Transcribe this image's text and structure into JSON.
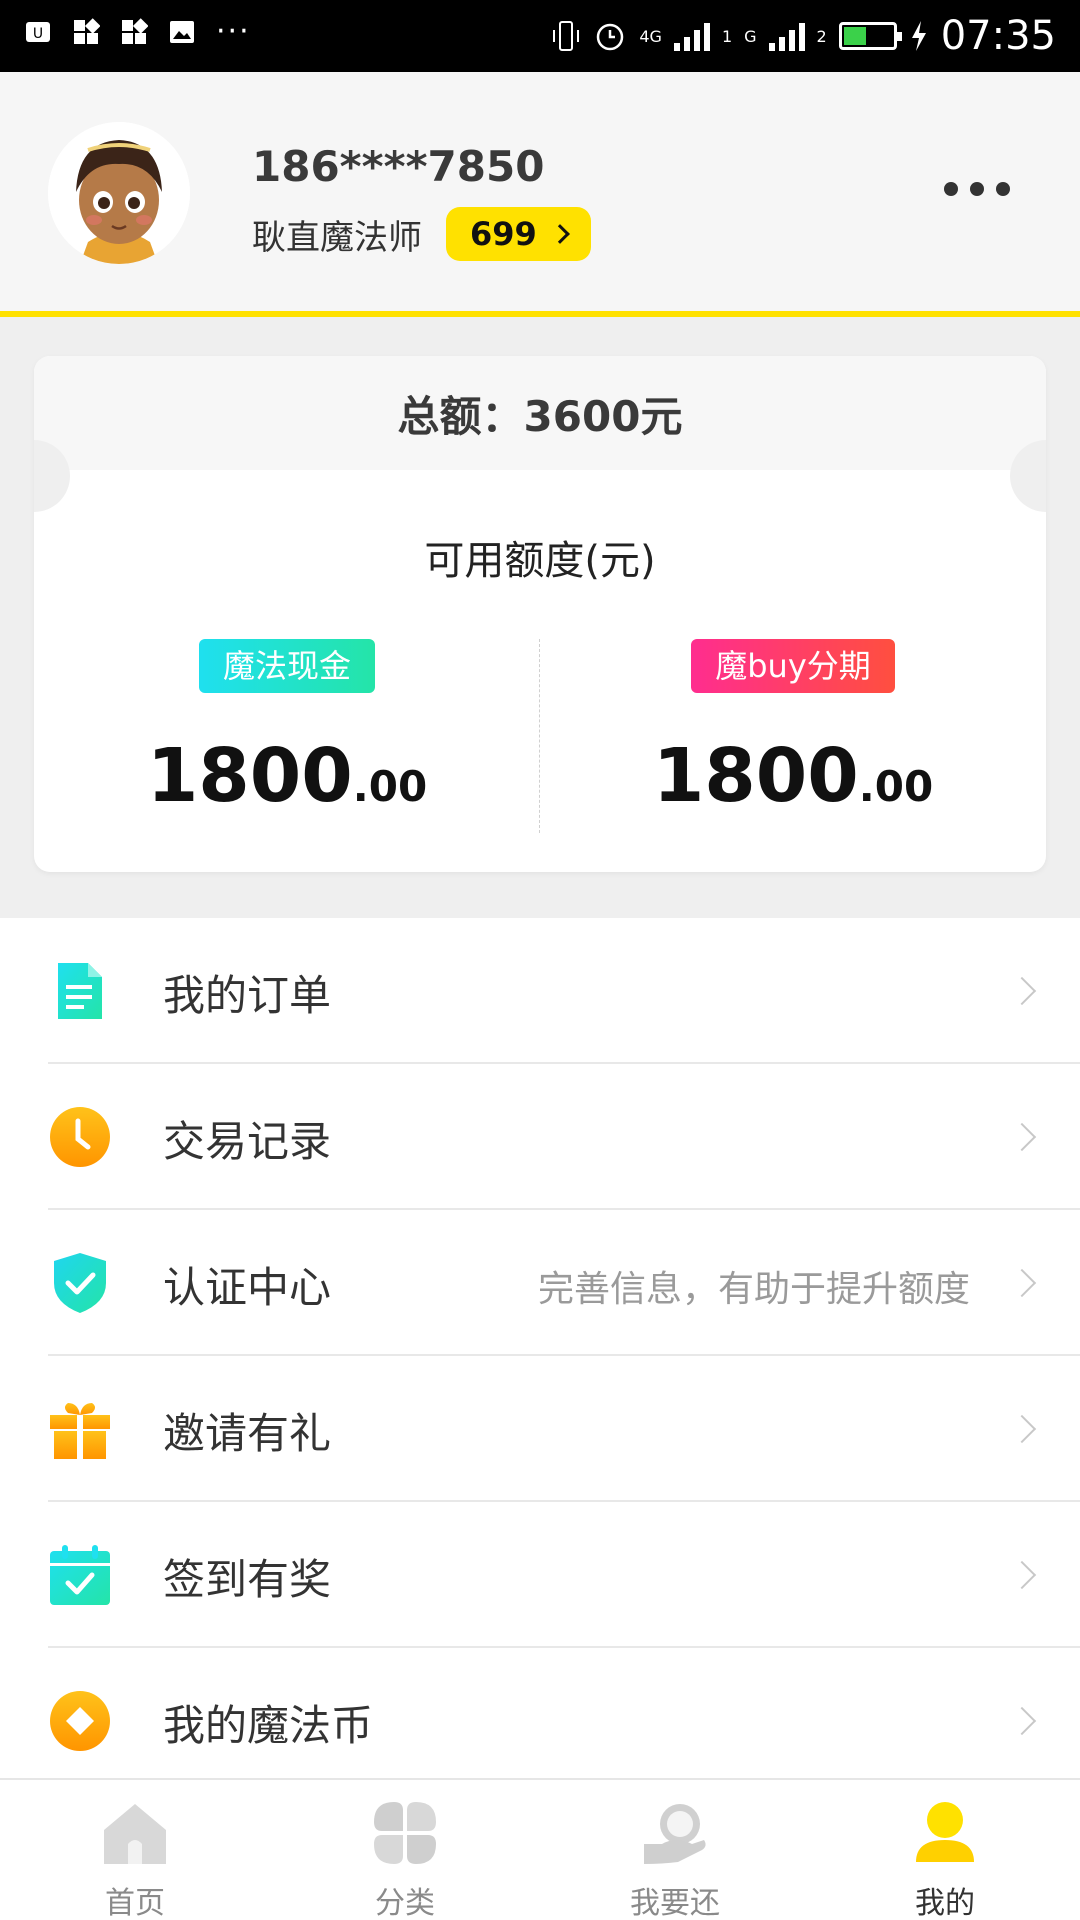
{
  "status_bar": {
    "network_1": "4G",
    "network_2": "G",
    "sim_1": "1",
    "sim_2": "2",
    "time": "07:35",
    "overflow": "···"
  },
  "profile": {
    "phone": "186****7850",
    "rank": "耿直魔法师",
    "score": "699"
  },
  "credit": {
    "total_label": "总额：3600元",
    "available_title": "可用额度(元)",
    "cash": {
      "tag": "魔法现金",
      "int": "1800",
      "dec": ".00"
    },
    "installment": {
      "tag": "魔buy分期",
      "int": "1800",
      "dec": ".00"
    }
  },
  "menu": [
    {
      "label": "我的订单",
      "hint": ""
    },
    {
      "label": "交易记录",
      "hint": ""
    },
    {
      "label": "认证中心",
      "hint": "完善信息，有助于提升额度"
    },
    {
      "label": "邀请有礼",
      "hint": ""
    },
    {
      "label": "签到有奖",
      "hint": ""
    },
    {
      "label": "我的魔法币",
      "hint": ""
    }
  ],
  "tabs": [
    {
      "label": "首页",
      "icon": "home-icon"
    },
    {
      "label": "分类",
      "icon": "category-icon"
    },
    {
      "label": "我要还",
      "icon": "repay-icon"
    },
    {
      "label": "我的",
      "icon": "profile-icon",
      "active": true
    }
  ],
  "colors": {
    "accent_yellow": "#ffe100",
    "cyan": "#1fe0ef",
    "green": "#24e4a8",
    "orange": "#ffa800",
    "pink": "#ff2d8f"
  }
}
